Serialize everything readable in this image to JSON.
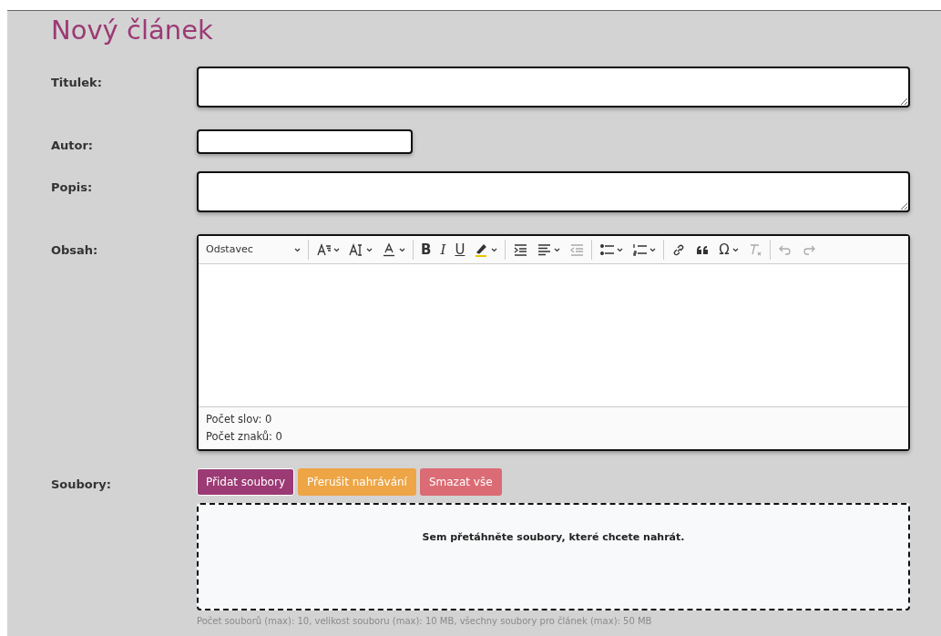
{
  "page_title": "Nový článek",
  "fields": [
    {
      "label": "Titulek:",
      "kind": "textarea"
    },
    {
      "label": "Autor:",
      "kind": "input"
    },
    {
      "label": "Popis:",
      "kind": "textarea"
    }
  ],
  "editor": {
    "label": "Obsah:",
    "toolbar": [
      {
        "kind": "dropdown",
        "text": "Odstavec"
      },
      {
        "kind": "separator"
      },
      {
        "kind": "fontsize",
        "caret": true,
        "disabled": false
      },
      {
        "kind": "fontfamily",
        "caret": true,
        "disabled": false
      },
      {
        "kind": "fontcolor",
        "caret": true,
        "disabled": false
      },
      {
        "kind": "separator"
      },
      {
        "kind": "bold",
        "text": "B",
        "caret": false,
        "disabled": false
      },
      {
        "kind": "italic",
        "text": "I",
        "caret": false,
        "disabled": false
      },
      {
        "kind": "underline",
        "text": "U",
        "caret": false,
        "disabled": false
      },
      {
        "kind": "highlight",
        "caret": true,
        "disabled": false
      },
      {
        "kind": "separator"
      },
      {
        "kind": "indent",
        "caret": false,
        "disabled": false
      },
      {
        "kind": "align",
        "caret": true,
        "disabled": false
      },
      {
        "kind": "outdent",
        "caret": false,
        "disabled": true
      },
      {
        "kind": "separator"
      },
      {
        "kind": "bullets",
        "caret": true,
        "disabled": false
      },
      {
        "kind": "numbers",
        "caret": true,
        "disabled": false
      },
      {
        "kind": "separator"
      },
      {
        "kind": "link",
        "caret": false,
        "disabled": false
      },
      {
        "kind": "quote",
        "caret": false,
        "disabled": false
      },
      {
        "kind": "special",
        "text": "Ω",
        "caret": true,
        "disabled": false
      },
      {
        "kind": "clearformat",
        "caret": false,
        "disabled": true
      },
      {
        "kind": "separator"
      },
      {
        "kind": "undo",
        "caret": false,
        "disabled": true
      },
      {
        "kind": "redo",
        "caret": false,
        "disabled": true
      }
    ],
    "word_count": "Počet slov: 0",
    "char_count": "Počet znaků: 0"
  },
  "files": {
    "label": "Soubory:",
    "buttons": [
      {
        "text": "Přidat soubory",
        "kind": "primary"
      },
      {
        "text": "Přerušit nahrávání",
        "kind": "warning"
      },
      {
        "text": "Smazat vše",
        "kind": "danger"
      }
    ],
    "dropzone_text": "Sem přetáhněte soubory, které chcete nahrát.",
    "hint": "Počet souborů (max): 10, velikost souboru (max): 10 MB, všechny soubory pro článek (max): 50 MB"
  }
}
